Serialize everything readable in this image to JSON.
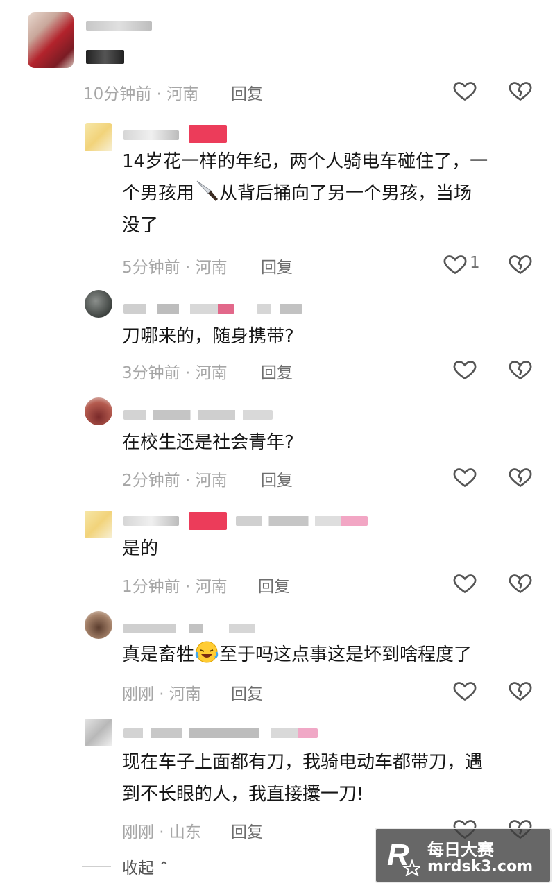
{
  "comments": [
    {
      "text": "",
      "time": "10分钟前 · 河南",
      "reply": "回复",
      "likes": ""
    },
    {
      "text_a": "14岁花一样的年纪，两个人骑电车碰住了，一",
      "text_b1": "个男孩用",
      "text_b2": "从背后捅向了另一个男孩，当场",
      "text_c": "没了",
      "time": "5分钟前 · 河南",
      "reply": "回复",
      "likes": "1"
    },
    {
      "text": "刀哪来的，随身携带?",
      "time": "3分钟前 · 河南",
      "reply": "回复",
      "likes": ""
    },
    {
      "text": "在校生还是社会青年?",
      "time": "2分钟前 · 河南",
      "reply": "回复",
      "likes": ""
    },
    {
      "text": "是的",
      "time": "1分钟前 · 河南",
      "reply": "回复",
      "likes": ""
    },
    {
      "text_a": "真是畜牲",
      "text_b": "至于吗这点事这是坏到啥程度了",
      "time": "刚刚 · 河南",
      "reply": "回复",
      "likes": ""
    },
    {
      "text_a": "现在车子上面都有刀，我骑电动车都带刀，遇",
      "text_b": "到不长眼的人，我直接攮一刀!",
      "time": "刚刚 · 山东",
      "reply": "回复",
      "likes": ""
    }
  ],
  "collapse_label": "收起",
  "watermark": {
    "cn": "每日大赛",
    "url": "mrdsk3.com"
  },
  "icons": {
    "like": "heart-outline-icon",
    "dislike": "broken-heart-icon",
    "collapse": "chevron-up-icon"
  },
  "colors": {
    "meta": "#a6a6a6",
    "reply": "#6e6e6e",
    "text": "#161616"
  }
}
